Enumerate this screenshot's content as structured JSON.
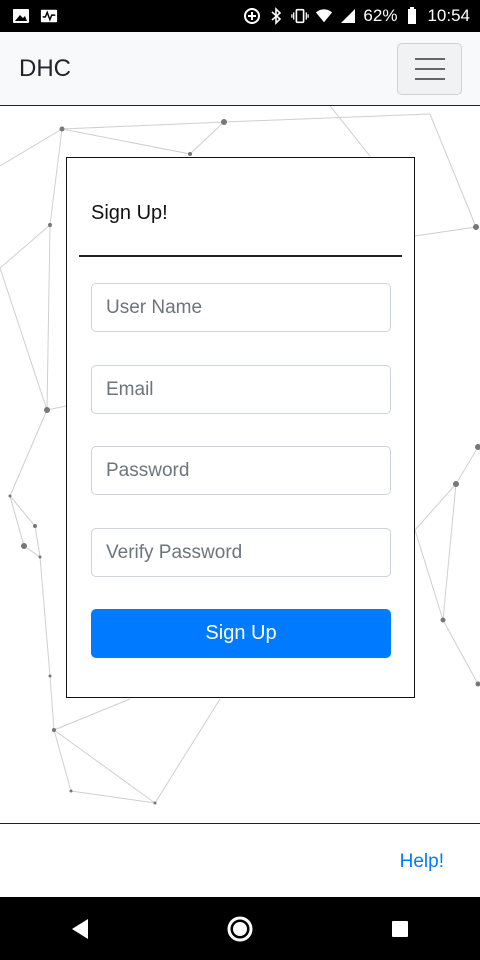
{
  "status_bar": {
    "battery": "62%",
    "time": "10:54",
    "icons_left": [
      "image-icon",
      "activity-icon"
    ],
    "icons_right": [
      "data-saver-icon",
      "bluetooth-icon",
      "vibrate-icon",
      "wifi-icon",
      "signal-icon",
      "battery-icon"
    ]
  },
  "navbar": {
    "brand": "DHC",
    "toggler_icon": "hamburger-icon"
  },
  "signup_card": {
    "title": "Sign Up!",
    "username_placeholder": "User Name",
    "email_placeholder": "Email",
    "password_placeholder": "Password",
    "verify_password_placeholder": "Verify Password",
    "submit_label": "Sign Up"
  },
  "footer": {
    "help_label": "Help!"
  },
  "android_nav": {
    "back_icon": "back-icon",
    "home_icon": "home-icon",
    "recents_icon": "recents-icon"
  },
  "colors": {
    "primary": "#007bff",
    "navbar_bg": "#f8f9fa"
  }
}
